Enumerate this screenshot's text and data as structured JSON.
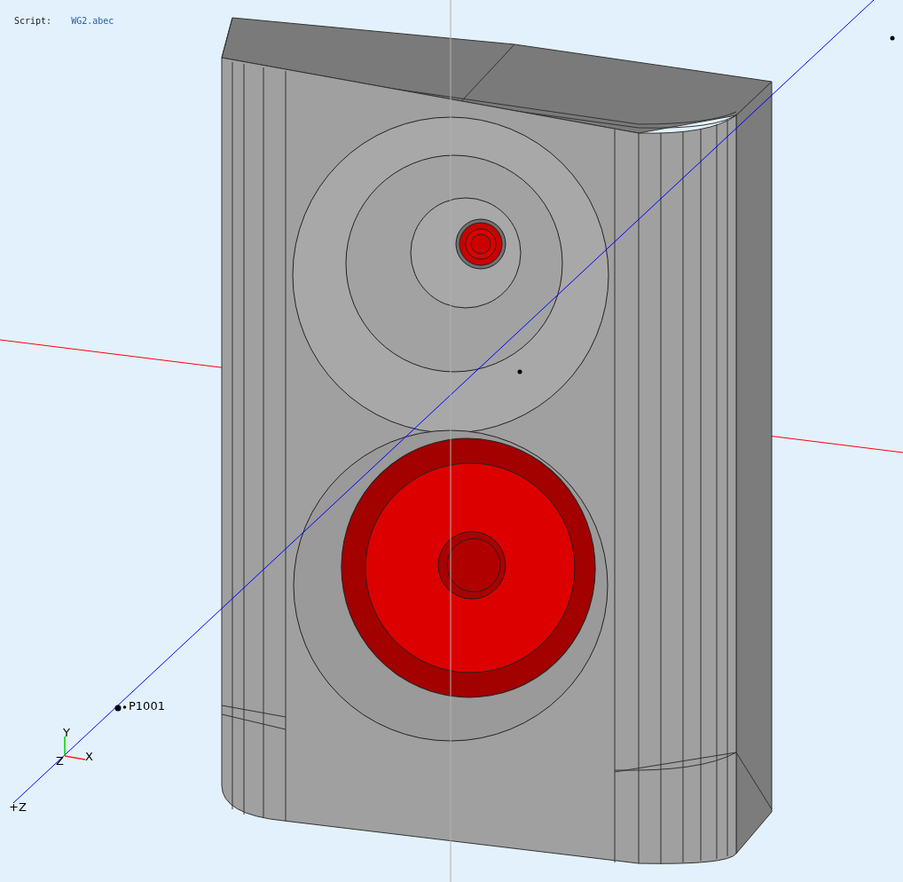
{
  "script": {
    "label": "Script:",
    "file": "WG2.abec"
  },
  "observation_point": {
    "label": "P1001"
  },
  "axes_gizmo": {
    "y": "Y",
    "z": "Z",
    "x": "X"
  },
  "axis_label": "+Z"
}
